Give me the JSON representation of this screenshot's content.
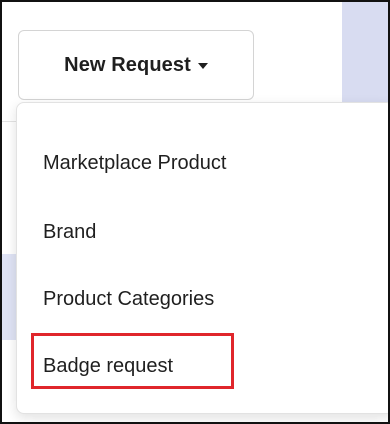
{
  "toolbar": {
    "new_request_label": "New Request",
    "caret_icon": "caret-down-icon"
  },
  "dropdown": {
    "items": [
      {
        "label": "Marketplace Product"
      },
      {
        "label": "Brand"
      },
      {
        "label": "Product Categories"
      },
      {
        "label": "Badge request",
        "highlighted": true
      }
    ],
    "highlight_color": "#e0262b"
  },
  "colors": {
    "text": "#1f1f1f",
    "accent_panel": "#d8dcf1",
    "highlight": "#e0262b"
  }
}
